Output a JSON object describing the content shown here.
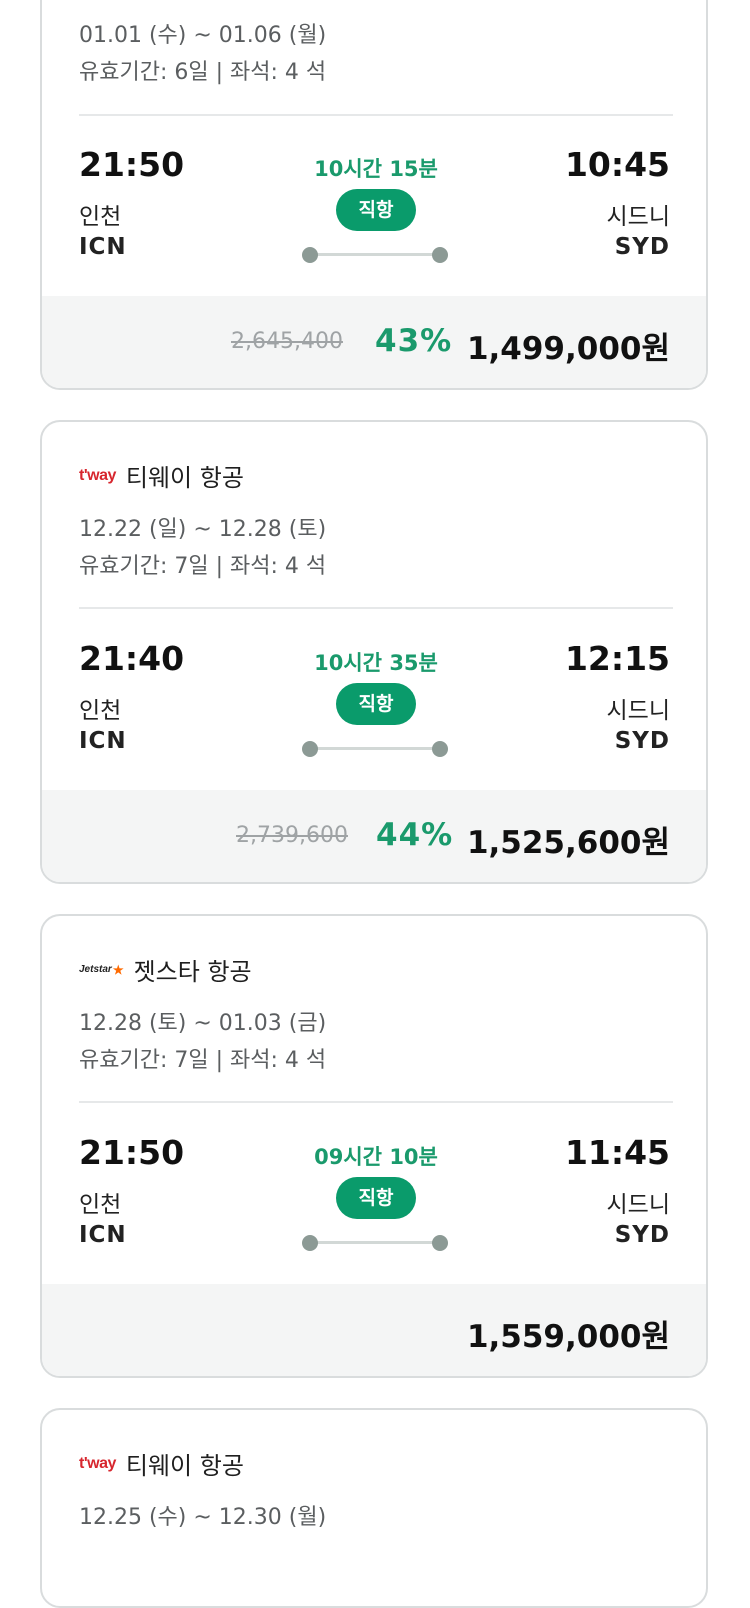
{
  "cards": [
    {
      "dates": "01.01 (수) ~ 01.06 (월)",
      "validity": "유효기간: 6일 | 좌석: 4 석",
      "dep_time": "21:50",
      "dep_city": "인천",
      "dep_code": "ICN",
      "duration": "10시간 15분",
      "badge": "직항",
      "arr_time": "10:45",
      "arr_city": "시드니",
      "arr_code": "SYD",
      "original_price": "2,645,400",
      "discount": "43%",
      "price": "1,499,000원"
    },
    {
      "airline_logo": "t'way",
      "airline": "티웨이 항공",
      "dates": "12.22 (일) ~ 12.28 (토)",
      "validity": "유효기간: 7일 | 좌석: 4 석",
      "dep_time": "21:40",
      "dep_city": "인천",
      "dep_code": "ICN",
      "duration": "10시간 35분",
      "badge": "직항",
      "arr_time": "12:15",
      "arr_city": "시드니",
      "arr_code": "SYD",
      "original_price": "2,739,600",
      "discount": "44%",
      "price": "1,525,600원"
    },
    {
      "airline_logo": "Jetstar",
      "airline": "젯스타 항공",
      "dates": "12.28 (토) ~ 01.03 (금)",
      "validity": "유효기간: 7일 | 좌석: 4 석",
      "dep_time": "21:50",
      "dep_city": "인천",
      "dep_code": "ICN",
      "duration": "09시간 10분",
      "badge": "직항",
      "arr_time": "11:45",
      "arr_city": "시드니",
      "arr_code": "SYD",
      "price": "1,559,000원"
    },
    {
      "airline_logo": "t'way",
      "airline": "티웨이 항공",
      "dates": "12.25 (수) ~ 12.30 (월)"
    }
  ]
}
